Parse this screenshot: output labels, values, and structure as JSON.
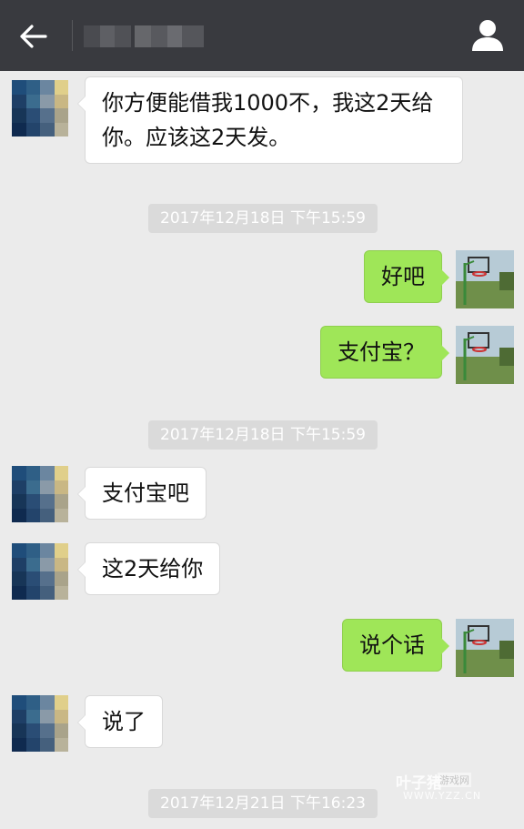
{
  "header": {
    "back_icon": "arrow-left-icon",
    "profile_icon": "person-icon"
  },
  "messages": [
    {
      "side": "left",
      "text": "你方便能借我1000不，我这2天给你。应该这2天发。"
    },
    {
      "timestamp": "2017年12月18日 下午15:59"
    },
    {
      "side": "right",
      "text": "好吧"
    },
    {
      "side": "right",
      "text": "支付宝？"
    },
    {
      "timestamp": "2017年12月18日 下午15:59"
    },
    {
      "side": "left",
      "text": "支付宝吧"
    },
    {
      "side": "left",
      "text": "这2天给你"
    },
    {
      "side": "right",
      "text": "说个话"
    },
    {
      "side": "left",
      "text": "说了"
    },
    {
      "timestamp": "2017年12月21日 下午16:23"
    }
  ],
  "watermark": {
    "brand": "叶子猪",
    "sub": "游戏网",
    "url": "WWW.YZZ.CN"
  },
  "colors": {
    "topbar": "#393a3f",
    "background": "#ebebeb",
    "sent_bubble": "#9fe658",
    "received_bubble": "#ffffff",
    "timestamp_bg": "#dadada"
  }
}
